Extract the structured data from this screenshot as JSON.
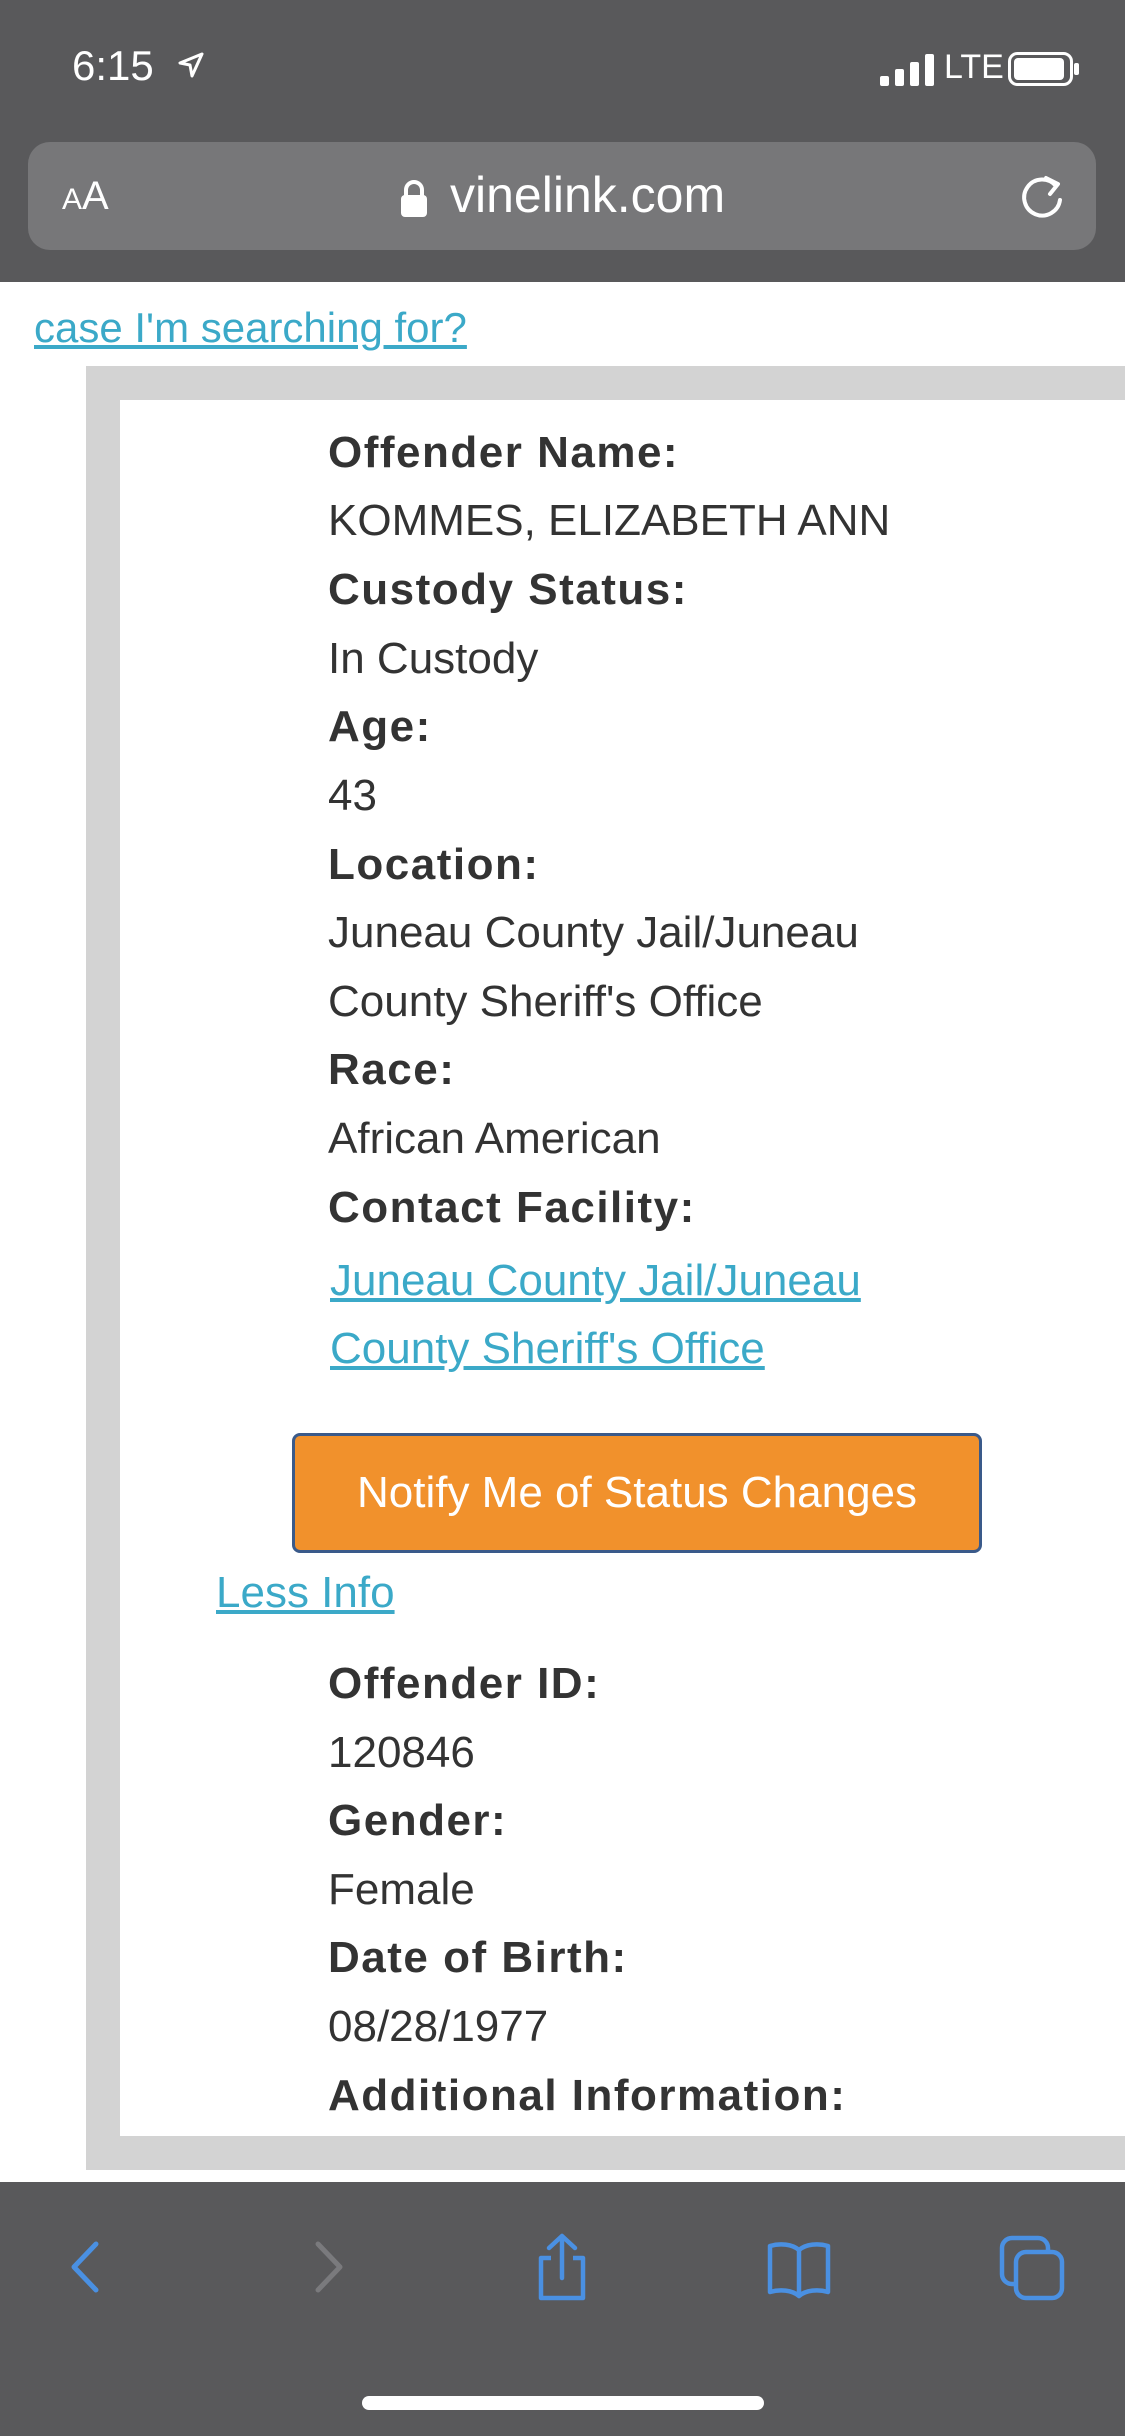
{
  "status_bar": {
    "time": "6:15",
    "network": "LTE",
    "icons": [
      "location-arrow-icon",
      "signal-bars-icon",
      "battery-icon"
    ]
  },
  "browser": {
    "text_size_button": {
      "small": "A",
      "big": "A"
    },
    "domain": "vinelink.com",
    "icons": [
      "lock-icon",
      "reload-icon"
    ]
  },
  "page": {
    "top_link": "case I'm searching for?",
    "fields": [
      {
        "label": "Offender Name:",
        "value": "KOMMES, ELIZABETH ANN"
      },
      {
        "label": "Custody Status:",
        "value": "In Custody"
      },
      {
        "label": "Age:",
        "value": "43"
      },
      {
        "label": "Location:",
        "value_lines": [
          "Juneau County Jail/Juneau",
          "County Sheriff's Office"
        ]
      },
      {
        "label": "Race:",
        "value": "African American"
      },
      {
        "label": "Contact Facility:",
        "link_lines": [
          "Juneau County Jail/Juneau",
          "County Sheriff's Office"
        ]
      }
    ],
    "notify_button": "Notify Me of Status Changes",
    "less_info": "Less Info",
    "more_fields": [
      {
        "label": "Offender ID:",
        "value": "120846"
      },
      {
        "label": "Gender:",
        "value": "Female"
      },
      {
        "label": "Date of Birth:",
        "value": "08/28/1977"
      },
      {
        "label": "Additional Information:"
      }
    ]
  },
  "toolbar": {
    "icons": [
      "back-icon",
      "forward-icon",
      "share-icon",
      "bookmarks-icon",
      "tabs-icon"
    ]
  },
  "colors": {
    "chrome": "#59595b",
    "link": "#3ba9c8",
    "button": "#f1912c",
    "toolbar_icon": "#4a90e2"
  }
}
